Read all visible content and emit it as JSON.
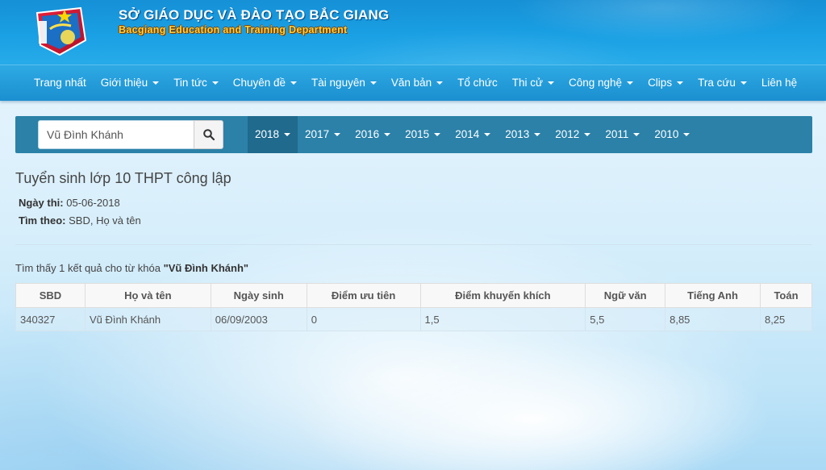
{
  "header": {
    "title": "SỞ GIÁO DỤC VÀ ĐÀO TẠO BẮC GIANG",
    "subtitle": "Bacgiang Education and Training Department",
    "logo_icon": "bacgiang-education-logo"
  },
  "nav": {
    "items": [
      {
        "label": "Trang nhất",
        "dropdown": false
      },
      {
        "label": "Giới thiệu",
        "dropdown": true
      },
      {
        "label": "Tin tức",
        "dropdown": true
      },
      {
        "label": "Chuyên đề",
        "dropdown": true
      },
      {
        "label": "Tài nguyên",
        "dropdown": true
      },
      {
        "label": "Văn bản",
        "dropdown": true
      },
      {
        "label": "Tổ chức",
        "dropdown": false
      },
      {
        "label": "Thi cử",
        "dropdown": true
      },
      {
        "label": "Công nghệ",
        "dropdown": true
      },
      {
        "label": "Clips",
        "dropdown": true
      },
      {
        "label": "Tra cứu",
        "dropdown": true
      },
      {
        "label": "Liên hệ",
        "dropdown": false
      }
    ]
  },
  "search": {
    "value": "Vũ Đình Khánh",
    "button_icon": "search-icon"
  },
  "years": {
    "active": "2018",
    "items": [
      "2018",
      "2017",
      "2016",
      "2015",
      "2014",
      "2013",
      "2012",
      "2011",
      "2010"
    ]
  },
  "content": {
    "title": "Tuyển sinh lớp 10 THPT công lập",
    "exam_date_label": "Ngày thi:",
    "exam_date": "05-06-2018",
    "search_by_label": "Tìm theo:",
    "search_by": "SBD, Họ và tên",
    "result_prefix": "Tìm thấy 1 kết quả cho từ khóa",
    "result_keyword": "\"Vũ Đình Khánh\""
  },
  "table": {
    "columns": [
      "SBD",
      "Họ và tên",
      "Ngày sinh",
      "Điểm ưu tiên",
      "Điểm khuyến khích",
      "Ngữ văn",
      "Tiếng Anh",
      "Toán"
    ],
    "rows": [
      [
        "340327",
        "Vũ Đình Khánh",
        "06/09/2003",
        "0",
        "1,5",
        "5,5",
        "8,85",
        "8,25"
      ]
    ]
  },
  "colors": {
    "banner": "#1a9de2",
    "nav": "#1b8fd0",
    "toolbar": "#2b81a8",
    "toolbar_active": "#1f6a8d"
  }
}
